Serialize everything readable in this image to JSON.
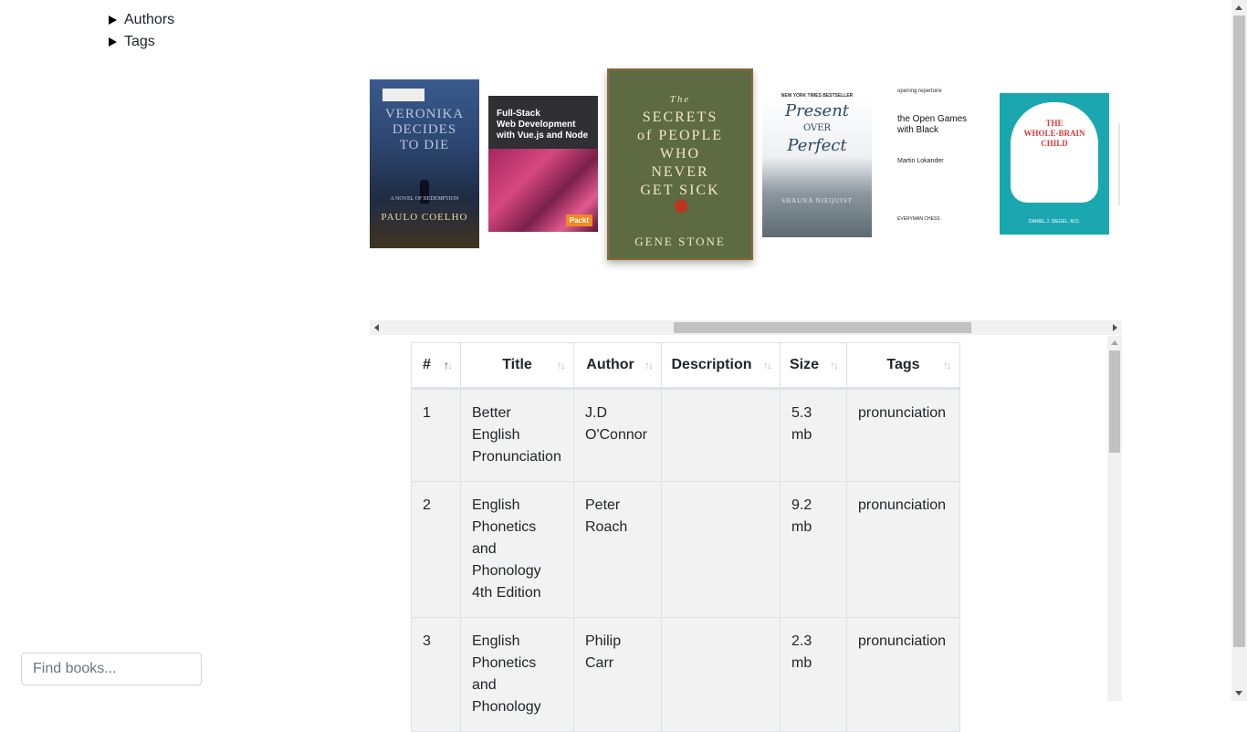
{
  "sidebar": {
    "tree": [
      {
        "label": "Authors"
      },
      {
        "label": "Tags"
      }
    ],
    "search_placeholder": "Find books..."
  },
  "carousel": {
    "books": [
      {
        "title_lines": [
          "VERONIKA",
          "DECIDES",
          "TO DIE"
        ],
        "subtitle": "A NOVEL OF REDEMPTION",
        "author": "PAULO COELHO"
      },
      {
        "title_lines": [
          "Full-Stack",
          "Web Development",
          "with Vue.js and Node"
        ],
        "publisher": "Packt"
      },
      {
        "title_lines": [
          "The",
          "SECRETS",
          "of PEOPLE",
          "WHO",
          "NEVER",
          "GET SICK"
        ],
        "author": "GENE STONE"
      },
      {
        "header": "NEW YORK TIMES BESTSELLER",
        "title_lines": [
          "Present",
          "OVER",
          "Perfect"
        ],
        "author": "SHAUNA NIEQUIST"
      },
      {
        "header": "opening repertoire",
        "title_lines": [
          "the Open Games",
          "with Black"
        ],
        "author": "Martin Lokander",
        "publisher": "EVERYMAN CHESS"
      },
      {
        "title_lines": [
          "THE",
          "WHOLE-BRAIN",
          "CHILD"
        ],
        "author": "DANIEL J. SIEGEL, M.D."
      }
    ]
  },
  "table": {
    "columns": [
      "#",
      "Title",
      "Author",
      "Description",
      "Size",
      "Tags"
    ],
    "rows": [
      {
        "num": "1",
        "title_lines": [
          "Better English",
          "Pronunciation"
        ],
        "author_lines": [
          "J.D",
          "O'Connor"
        ],
        "description": "",
        "size_lines": [
          "5.3",
          "mb"
        ],
        "tags": "pronunciation"
      },
      {
        "num": "2",
        "title_lines": [
          "English",
          "Phonetics",
          "and",
          "Phonology",
          "4th Edition"
        ],
        "author_lines": [
          "Peter",
          "Roach"
        ],
        "description": "",
        "size_lines": [
          "9.2",
          "mb"
        ],
        "tags": "pronunciation"
      },
      {
        "num": "3",
        "title_lines": [
          "English",
          "Phonetics",
          "and",
          "Phonology"
        ],
        "author_lines": [
          "Philip",
          "Carr"
        ],
        "description": "",
        "size_lines": [
          "2.3",
          "mb"
        ],
        "tags": "pronunciation"
      }
    ]
  },
  "colors": {
    "accent": "#212529",
    "row_bg": "#f2f2f2",
    "border": "#dee2e6"
  }
}
